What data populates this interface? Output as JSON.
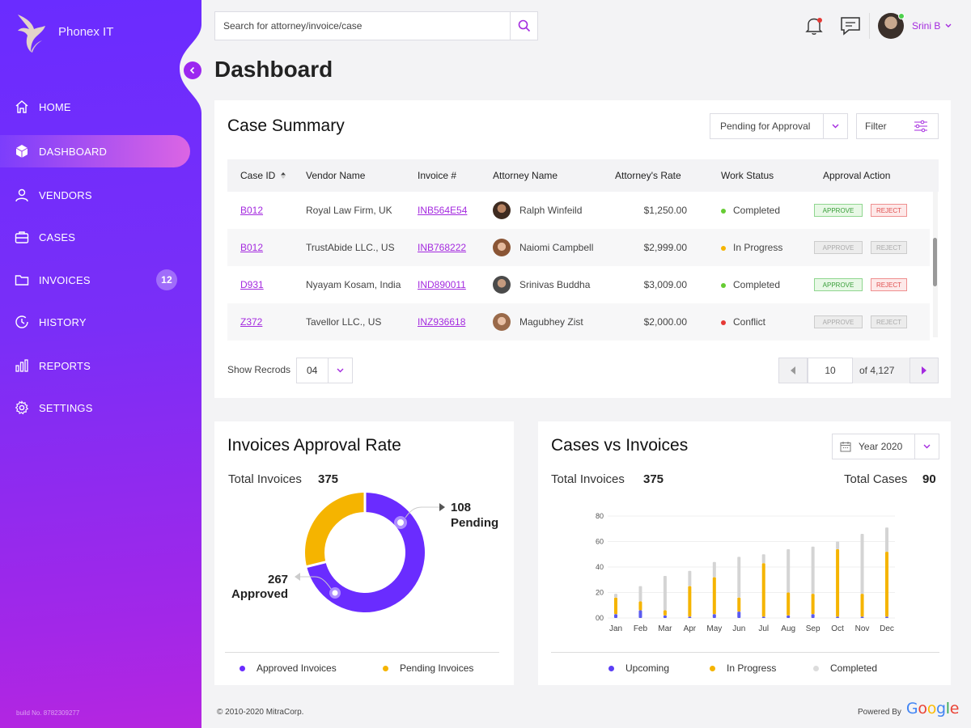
{
  "brand": {
    "name": "Phonex IT"
  },
  "sidebar": {
    "items": [
      {
        "label": "HOME",
        "icon": "home-icon"
      },
      {
        "label": "DASHBOARD",
        "icon": "cube-icon",
        "active": true
      },
      {
        "label": "VENDORS",
        "icon": "user-icon"
      },
      {
        "label": "CASES",
        "icon": "briefcase-icon"
      },
      {
        "label": "INVOICES",
        "icon": "folder-icon",
        "badge": "12"
      },
      {
        "label": "HISTORY",
        "icon": "history-icon"
      },
      {
        "label": "REPORTS",
        "icon": "bar-chart-icon"
      },
      {
        "label": "SETTINGS",
        "icon": "gear-icon"
      }
    ],
    "build": "build No. 8782309277"
  },
  "header": {
    "search_placeholder": "Search for attorney/invoice/case",
    "user_name": "Srini B"
  },
  "page_title": "Dashboard",
  "case_summary": {
    "title": "Case Summary",
    "status_filter": "Pending for Approval",
    "filter_label": "Filter",
    "columns": [
      "Case ID",
      "Vendor Name",
      "Invoice #",
      "Attorney Name",
      "Attorney's Rate",
      "Work Status",
      "Approval Action"
    ],
    "rows": [
      {
        "case_id": "B012",
        "vendor": "Royal Law Firm, UK",
        "invoice": "INB564E54",
        "attorney": "Ralph Winfeild",
        "rate": "$1,250.00",
        "status": "Completed",
        "status_color": "#66cc33",
        "actions_enabled": true
      },
      {
        "case_id": "B012",
        "vendor": "TrustAbide LLC., US",
        "invoice": "INB768222",
        "attorney": "Naiomi Campbell",
        "rate": "$2,999.00",
        "status": "In Progress",
        "status_color": "#f5b400",
        "actions_enabled": false
      },
      {
        "case_id": "D931",
        "vendor": "Nyayam Kosam, India",
        "invoice": "IND890011",
        "attorney": "Srinivas Buddha",
        "rate": "$3,009.00",
        "status": "Completed",
        "status_color": "#66cc33",
        "actions_enabled": true
      },
      {
        "case_id": "Z372",
        "vendor": "Tavellor LLC., US",
        "invoice": "INZ936618",
        "attorney": "Magubhey Zist",
        "rate": "$2,000.00",
        "status": "Conflict",
        "status_color": "#e53935",
        "actions_enabled": false
      }
    ],
    "approve_label": "APPROVE",
    "reject_label": "REJECT",
    "show_records_label": "Show Recrods",
    "records_per_page": "04",
    "page_number": "10",
    "page_total": "of 4,127"
  },
  "approval_rate": {
    "title": "Invoices Approval Rate",
    "total_label": "Total Invoices",
    "total_value": "375",
    "approved_value": "267",
    "approved_label": "Approved",
    "pending_value": "108",
    "pending_label": "Pending",
    "legend": [
      "Approved Invoices",
      "Pending Invoices"
    ]
  },
  "cases_vs_invoices": {
    "title": "Cases vs Invoices",
    "year": "Year 2020",
    "total_invoices_label": "Total Invoices",
    "total_invoices_value": "375",
    "total_cases_label": "Total Cases",
    "total_cases_value": "90",
    "legend": [
      "Upcoming",
      "In Progress",
      "Completed"
    ]
  },
  "chart_data": [
    {
      "type": "pie",
      "title": "Invoices Approval Rate",
      "labels": [
        "Approved",
        "Pending"
      ],
      "values": [
        267,
        108
      ],
      "colors": [
        "#6a2cff",
        "#f5b400"
      ]
    },
    {
      "type": "bar",
      "title": "Cases vs Invoices",
      "categories": [
        "Jan",
        "Feb",
        "Mar",
        "Apr",
        "May",
        "Jun",
        "Jul",
        "Aug",
        "Sep",
        "Oct",
        "Nov",
        "Dec"
      ],
      "y_ticks": [
        "00",
        "20",
        "40",
        "60",
        "80"
      ],
      "ylim": [
        0,
        80
      ],
      "series": [
        {
          "name": "Upcoming",
          "color": "#5b5bf0",
          "values": [
            3,
            6,
            2,
            1,
            3,
            5,
            1,
            2,
            3,
            1,
            1,
            1
          ]
        },
        {
          "name": "In Progress",
          "color": "#f5b400",
          "values": [
            13,
            7,
            4,
            24,
            29,
            11,
            42,
            18,
            16,
            53,
            18,
            51
          ]
        },
        {
          "name": "Completed",
          "color": "#d4d4d4",
          "values": [
            3,
            12,
            27,
            12,
            12,
            32,
            7,
            34,
            37,
            6,
            47,
            19
          ]
        }
      ]
    }
  ],
  "footer": {
    "copyright": "© 2010-2020 MitraCorp.",
    "powered_by": "Powered By",
    "google": "Google"
  },
  "colors": {
    "accent": "#a42adf",
    "sidebar_top": "#6a2cff",
    "sidebar_bottom": "#b526e0"
  }
}
